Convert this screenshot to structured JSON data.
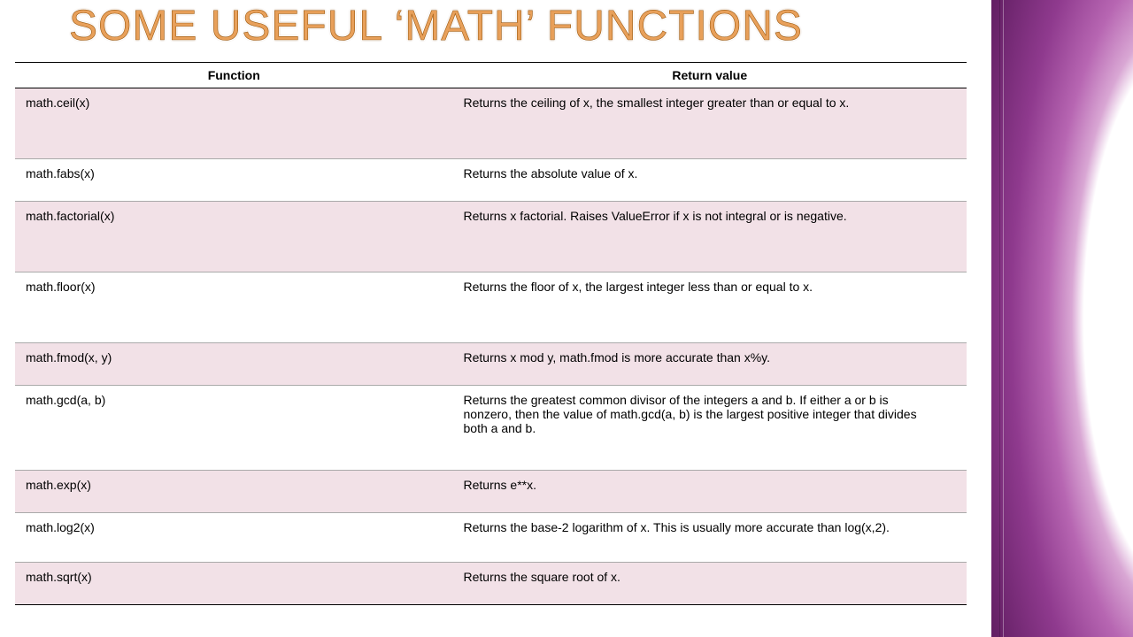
{
  "title": "Some useful ‘math’ functions",
  "table": {
    "headers": {
      "function": "Function",
      "return_value": "Return value"
    },
    "rows": [
      {
        "fn": "math.ceil(x)",
        "rv": "Returns the ceiling of x, the smallest integer greater than or equal to x."
      },
      {
        "fn": "math.fabs(x)",
        "rv": "Returns the absolute value of x."
      },
      {
        "fn": "math.factorial(x)",
        "rv": "Returns x factorial. Raises ValueError if x is not integral or is negative."
      },
      {
        "fn": "math.floor(x)",
        "rv": "Returns the floor of x, the largest integer less than or equal to x."
      },
      {
        "fn": "math.fmod(x, y)",
        "rv": "Returns x mod y, math.fmod is more accurate than x%y."
      },
      {
        "fn": "math.gcd(a, b)",
        "rv": "Returns the greatest common divisor of the integers a and b. If either a or b is nonzero, then the value of math.gcd(a, b) is the largest positive integer that divides both a and b."
      },
      {
        "fn": "math.exp(x)",
        "rv": "Returns e**x."
      },
      {
        "fn": "math.log2(x)",
        "rv": "Returns the base-2 logarithm of x. This is usually more accurate than log(x,2)."
      },
      {
        "fn": "math.sqrt(x)",
        "rv": "Returns the square root of x."
      }
    ]
  }
}
